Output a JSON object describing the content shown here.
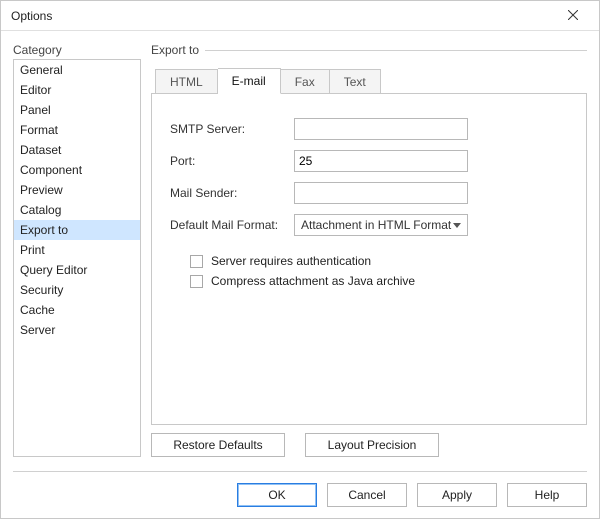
{
  "window": {
    "title": "Options"
  },
  "sidebar": {
    "label": "Category",
    "items": [
      {
        "label": "General"
      },
      {
        "label": "Editor"
      },
      {
        "label": "Panel"
      },
      {
        "label": "Format"
      },
      {
        "label": "Dataset"
      },
      {
        "label": "Component"
      },
      {
        "label": "Preview"
      },
      {
        "label": "Catalog"
      },
      {
        "label": "Export to"
      },
      {
        "label": "Print"
      },
      {
        "label": "Query Editor"
      },
      {
        "label": "Security"
      },
      {
        "label": "Cache"
      },
      {
        "label": "Server"
      }
    ],
    "selected": 8
  },
  "main": {
    "group_label": "Export to",
    "tabs": [
      {
        "label": "HTML"
      },
      {
        "label": "E-mail"
      },
      {
        "label": "Fax"
      },
      {
        "label": "Text"
      }
    ],
    "active_tab": 1,
    "email_form": {
      "smtp_label": "SMTP Server:",
      "smtp_value": "",
      "port_label": "Port:",
      "port_value": "25",
      "sender_label": "Mail Sender:",
      "sender_value": "",
      "format_label": "Default Mail Format:",
      "format_value": "Attachment in HTML Format",
      "auth_label": "Server requires authentication",
      "compress_label": "Compress attachment as Java archive"
    },
    "restore_defaults": "Restore Defaults",
    "layout_precision": "Layout Precision"
  },
  "footer": {
    "ok": "OK",
    "cancel": "Cancel",
    "apply": "Apply",
    "help": "Help"
  }
}
